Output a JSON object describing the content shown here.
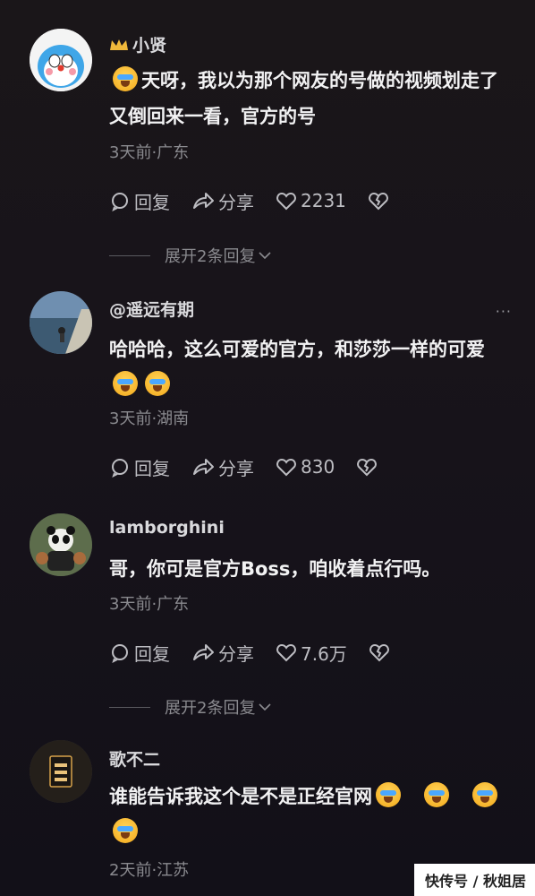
{
  "comments": [
    {
      "username": "小贤",
      "text": "天呀，我以为那个网友的号做的视频划走了又倒回来一看，官方的号",
      "meta": "3天前·广东",
      "reply_label": "回复",
      "share_label": "分享",
      "likes": "2231",
      "expand": "展开2条回复"
    },
    {
      "username": "@遥远有期",
      "text": "哈哈哈，这么可爱的官方，和莎莎一样的可爱",
      "meta": "3天前·湖南",
      "reply_label": "回复",
      "share_label": "分享",
      "likes": "830",
      "more": "···"
    },
    {
      "username": "lamborghini",
      "text": "哥，你可是官方Boss，咱收着点行吗。",
      "meta": "3天前·广东",
      "reply_label": "回复",
      "share_label": "分享",
      "likes": "7.6万",
      "expand": "展开2条回复"
    },
    {
      "username": "歌不二",
      "text": "谁能告诉我这个是不是正经官网",
      "meta": "2天前·江苏"
    }
  ],
  "watermark": "快传号 / 秋姐居",
  "colors": {
    "background": "#17131a",
    "meta": "#8a8a8f",
    "text": "#f2f2f3"
  }
}
